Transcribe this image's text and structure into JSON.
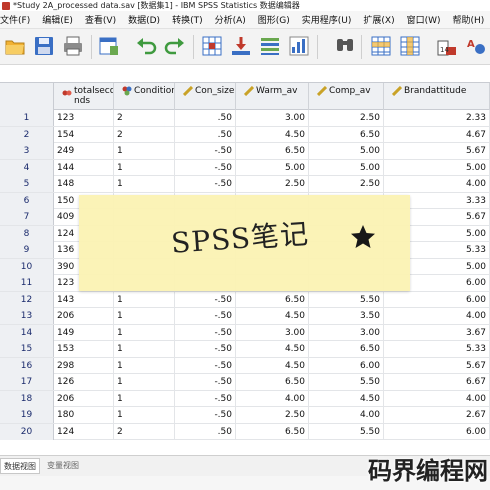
{
  "window": {
    "title": "*Study 2A_processed data.sav [数据集1] - IBM SPSS Statistics 数据编辑器"
  },
  "menu": [
    "文件(F)",
    "编辑(E)",
    "查看(V)",
    "数据(D)",
    "转换(T)",
    "分析(A)",
    "图形(G)",
    "实用程序(U)",
    "扩展(X)",
    "窗口(W)",
    "帮助(H)"
  ],
  "toolbar": [
    "open-folder-icon",
    "save-icon",
    "print-icon",
    "dialog-recall-icon",
    "undo-icon",
    "redo-icon",
    "goto-case-icon",
    "goto-variable-icon",
    "variables-icon",
    "run-descriptive-icon",
    "find-icon",
    "insert-cases-icon",
    "insert-variable-icon",
    "split-file-icon",
    "value-labels-icon"
  ],
  "columns": [
    {
      "label": "totalseconds",
      "label_line1": "totalseco",
      "label_line2": "nds",
      "type": "scale"
    },
    {
      "label": "Condition",
      "type": "nominal"
    },
    {
      "label": "Con_size",
      "type": "scale"
    },
    {
      "label": "Warm_av",
      "type": "scale"
    },
    {
      "label": "Comp_av",
      "type": "scale"
    },
    {
      "label": "Brandattitude",
      "type": "scale"
    }
  ],
  "rows": [
    {
      "n": "1",
      "cells": [
        "123",
        "2",
        ".50",
        "3.00",
        "2.50",
        "2.33"
      ]
    },
    {
      "n": "2",
      "cells": [
        "154",
        "2",
        ".50",
        "4.50",
        "6.50",
        "4.67"
      ]
    },
    {
      "n": "3",
      "cells": [
        "249",
        "1",
        "-.50",
        "6.50",
        "5.00",
        "5.67"
      ]
    },
    {
      "n": "4",
      "cells": [
        "144",
        "1",
        "-.50",
        "5.00",
        "5.00",
        "5.00"
      ]
    },
    {
      "n": "5",
      "cells": [
        "148",
        "1",
        "-.50",
        "2.50",
        "2.50",
        "4.00"
      ]
    },
    {
      "n": "6",
      "cells": [
        "150",
        "",
        "",
        "",
        "",
        "3.33"
      ]
    },
    {
      "n": "7",
      "cells": [
        "409",
        "",
        "",
        "",
        "",
        "5.67"
      ]
    },
    {
      "n": "8",
      "cells": [
        "124",
        "",
        "",
        "",
        "",
        "5.00"
      ]
    },
    {
      "n": "9",
      "cells": [
        "136",
        "",
        "",
        "",
        "",
        "5.33"
      ]
    },
    {
      "n": "10",
      "cells": [
        "390",
        "",
        "",
        "",
        "",
        "5.00"
      ]
    },
    {
      "n": "11",
      "cells": [
        "123",
        "",
        "",
        "",
        "",
        "6.00"
      ]
    },
    {
      "n": "12",
      "cells": [
        "143",
        "1",
        "-.50",
        "6.50",
        "5.50",
        "6.00"
      ]
    },
    {
      "n": "13",
      "cells": [
        "206",
        "1",
        "-.50",
        "4.50",
        "3.50",
        "4.00"
      ]
    },
    {
      "n": "14",
      "cells": [
        "149",
        "1",
        "-.50",
        "3.00",
        "3.00",
        "3.67"
      ]
    },
    {
      "n": "15",
      "cells": [
        "153",
        "1",
        "-.50",
        "4.50",
        "6.50",
        "5.33"
      ]
    },
    {
      "n": "16",
      "cells": [
        "298",
        "1",
        "-.50",
        "4.50",
        "6.00",
        "5.67"
      ]
    },
    {
      "n": "17",
      "cells": [
        "126",
        "1",
        "-.50",
        "6.50",
        "5.50",
        "6.67"
      ]
    },
    {
      "n": "18",
      "cells": [
        "206",
        "1",
        "-.50",
        "4.00",
        "4.50",
        "4.00"
      ]
    },
    {
      "n": "19",
      "cells": [
        "180",
        "1",
        "-.50",
        "2.50",
        "4.00",
        "2.67"
      ]
    },
    {
      "n": "20",
      "cells": [
        "124",
        "2",
        ".50",
        "6.50",
        "5.50",
        "6.00"
      ]
    }
  ],
  "tabs": {
    "data_view": "数据视图",
    "variable_view": "变量视图"
  },
  "note": {
    "text": "SPSS笔记"
  },
  "watermark": "码界编程网",
  "colors": {
    "rownum_text": "#1a2a6c",
    "header_bg": "#eef0f3",
    "note_bg": "#fbf3b5"
  }
}
